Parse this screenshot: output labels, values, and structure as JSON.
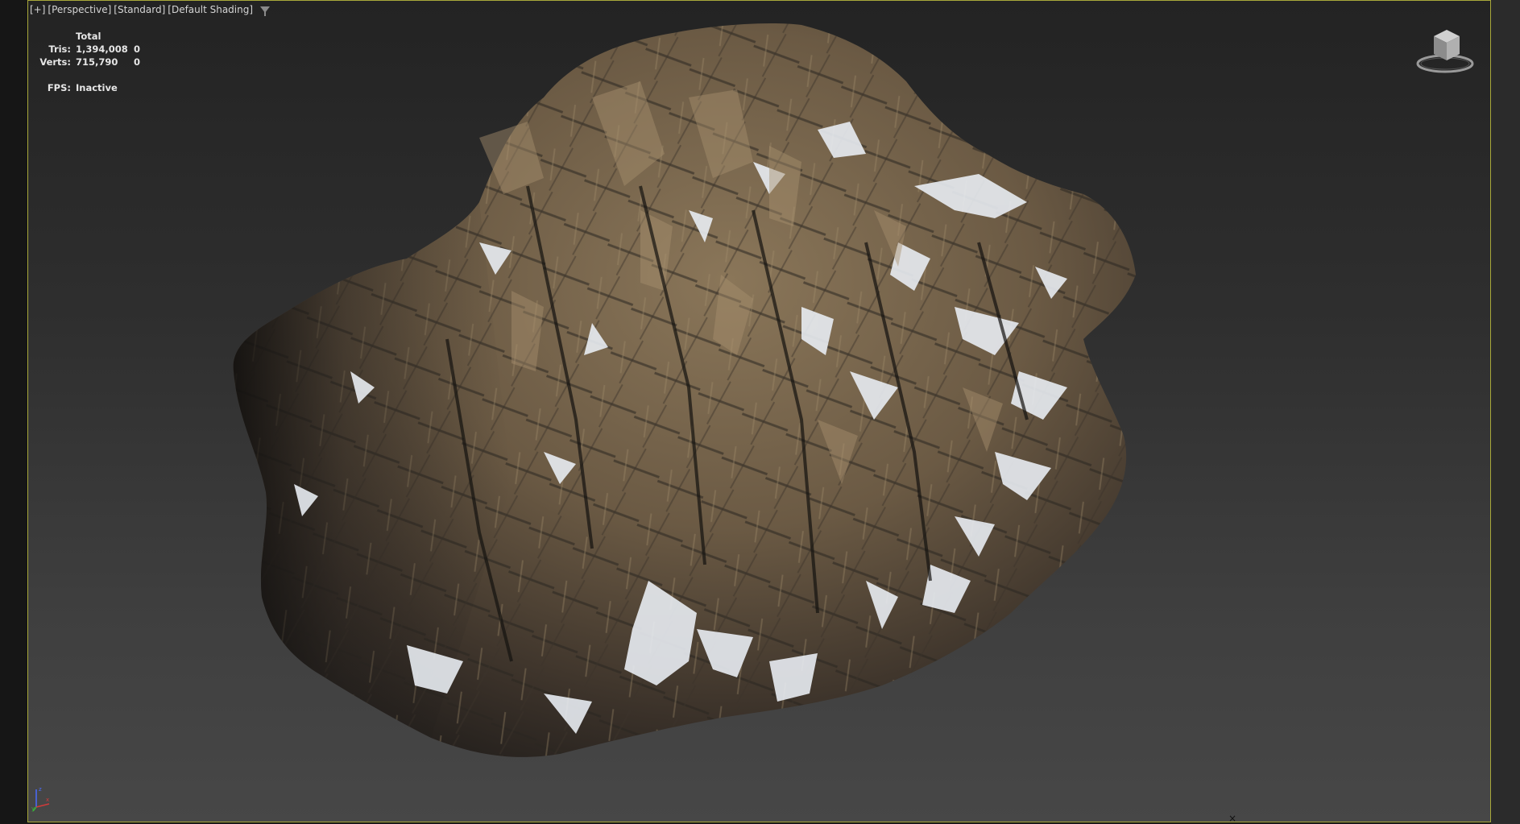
{
  "viewport": {
    "labels": [
      "[+]",
      "[Perspective]",
      "[Standard]",
      "[Default Shading]"
    ],
    "filter_icon": "filter-icon",
    "border_color": "#a8a83a"
  },
  "stats": {
    "header": "Total",
    "rows": [
      {
        "label": "Tris:",
        "total": "1,394,008",
        "selected": "0"
      },
      {
        "label": "Verts:",
        "total": "715,790",
        "selected": "0"
      }
    ],
    "fps_label": "FPS:",
    "fps_value": "Inactive"
  },
  "navigation": {
    "viewcube_icon": "viewcube-icon",
    "axis_icon": "axis-tripod-icon",
    "axis_labels": [
      "x",
      "y",
      "z"
    ]
  },
  "colors": {
    "rock_base": "#6b5a44",
    "rock_shadow": "#1f1c1a",
    "snow": "#e8ecf2"
  }
}
